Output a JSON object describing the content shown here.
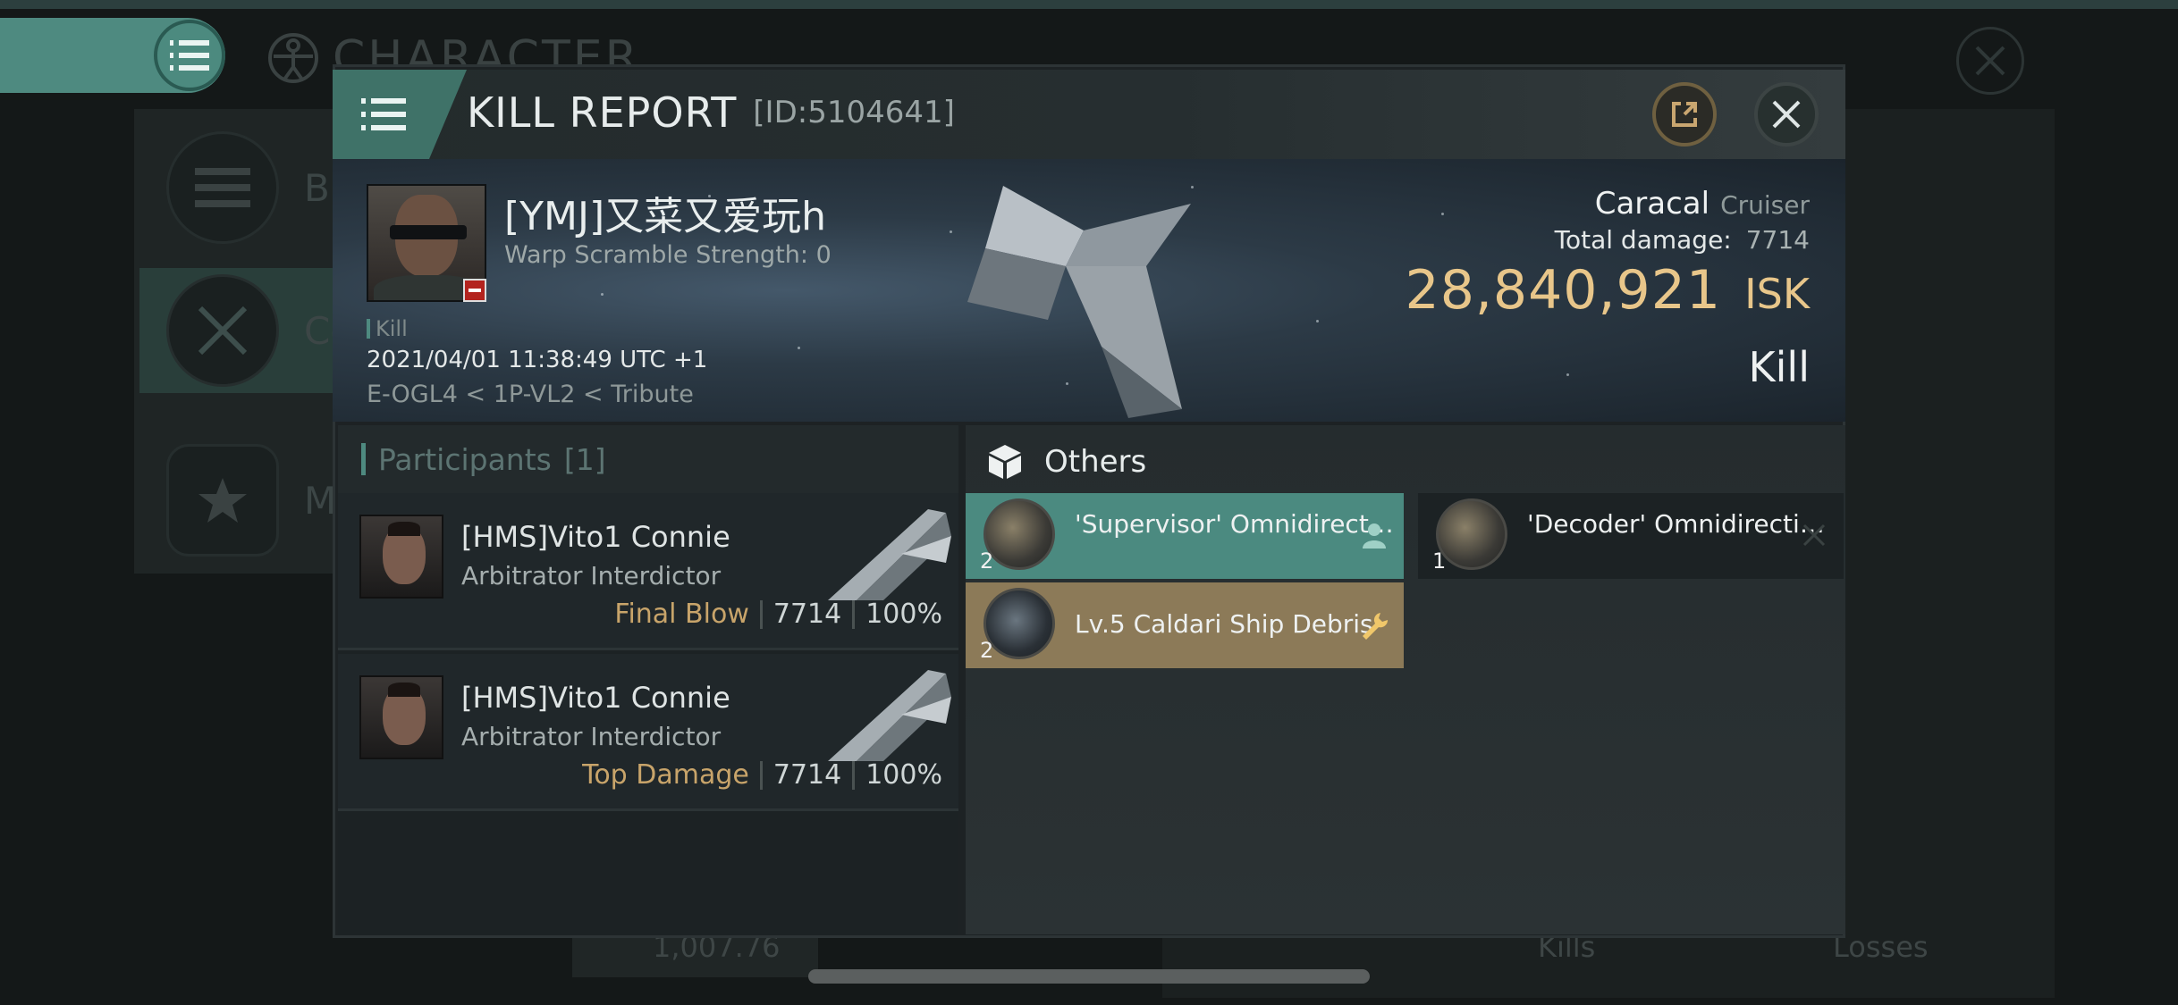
{
  "background": {
    "screen_title": "CHARACTER",
    "sidebar": [
      {
        "label": "Bio",
        "icon": "list-icon"
      },
      {
        "label": "Co",
        "icon": "crossed-swords-icon"
      },
      {
        "label": "Me",
        "icon": "star-badge-icon"
      }
    ],
    "bottom": {
      "value": "1,007.76",
      "kills_label": "Kills",
      "losses_label": "Losses"
    }
  },
  "modal": {
    "title": "KILL REPORT",
    "id_label": "[ID:5104641]"
  },
  "victim": {
    "name": "[YMJ]又菜又爱玩h",
    "warp": "Warp Scramble Strength: 0",
    "tag": "Kill",
    "datetime": "2021/04/01 11:38:49 UTC +1",
    "location": "E-OGL4 < 1P-VL2 < Tribute",
    "ship_name": "Caracal",
    "ship_class": "Cruiser",
    "total_damage_label": "Total damage:",
    "total_damage": "7714",
    "isk_value": "28,840,921",
    "isk_unit": "ISK",
    "result": "Kill"
  },
  "participants": {
    "title": "Participants",
    "count": "[1]",
    "rows": [
      {
        "name": "[HMS]Vito1 Connie",
        "ship": "Arbitrator Interdictor",
        "role": "Final Blow",
        "damage": "7714",
        "percent": "100%"
      },
      {
        "name": "[HMS]Vito1 Connie",
        "ship": "Arbitrator Interdictor",
        "role": "Top Damage",
        "damage": "7714",
        "percent": "100%"
      }
    ]
  },
  "others": {
    "title": "Others",
    "items": [
      {
        "label": "'Supervisor' Omnidirectional...",
        "qty": "2"
      },
      {
        "label": "'Decoder' Omnidirectional...",
        "qty": "1"
      },
      {
        "label": "Lv.5 Caldari Ship Debris",
        "qty": "2"
      }
    ]
  },
  "colors": {
    "accent": "#4b8a80",
    "isk": "#e8c68a",
    "role": "#c8a46a",
    "debris": "#8c7a58"
  }
}
